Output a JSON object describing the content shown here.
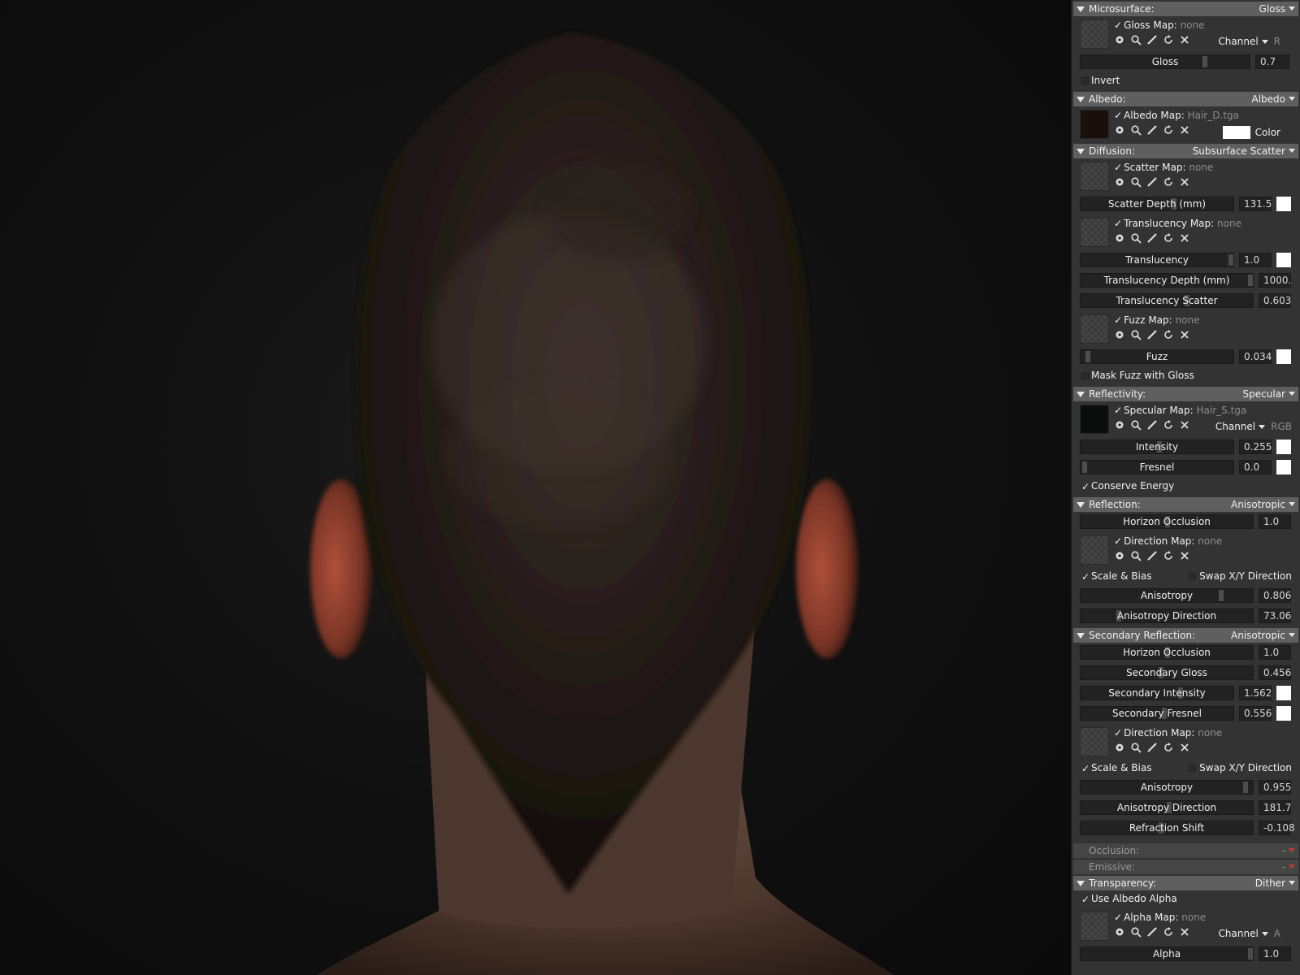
{
  "panel": {
    "microsurface": {
      "title": "Microsurface:",
      "mode": "Gloss",
      "map_label": "Gloss Map:",
      "map_value": "none",
      "channel_label": "Channel",
      "channel_value": "R",
      "gloss_label": "Gloss",
      "gloss_value": "0.7",
      "invert_label": "Invert"
    },
    "albedo": {
      "title": "Albedo:",
      "mode": "Albedo",
      "map_label": "Albedo Map:",
      "map_value": "Hair_D.tga",
      "color_label": "Color"
    },
    "diffusion": {
      "title": "Diffusion:",
      "mode": "Subsurface Scatter",
      "scatter_map_label": "Scatter Map:",
      "scatter_map_value": "none",
      "scatter_depth_label": "Scatter Depth (mm)",
      "scatter_depth_value": "131.5",
      "translucency_map_label": "Translucency Map:",
      "translucency_map_value": "none",
      "translucency_label": "Translucency",
      "translucency_value": "1.0",
      "translucency_depth_label": "Translucency Depth (mm)",
      "translucency_depth_value": "1000.",
      "translucency_scatter_label": "Translucency Scatter",
      "translucency_scatter_value": "0.603",
      "fuzz_map_label": "Fuzz Map:",
      "fuzz_map_value": "none",
      "fuzz_label": "Fuzz",
      "fuzz_value": "0.034",
      "mask_fuzz_label": "Mask Fuzz with Gloss"
    },
    "reflectivity": {
      "title": "Reflectivity:",
      "mode": "Specular",
      "map_label": "Specular Map:",
      "map_value": "Hair_S.tga",
      "channel_label": "Channel",
      "channel_value": "RGB",
      "intensity_label": "Intensity",
      "intensity_value": "0.255",
      "fresnel_label": "Fresnel",
      "fresnel_value": "0.0",
      "conserve_label": "Conserve Energy"
    },
    "reflection": {
      "title": "Reflection:",
      "mode": "Anisotropic",
      "horizon_label": "Horizon Occlusion",
      "horizon_value": "1.0",
      "direction_map_label": "Direction Map:",
      "direction_map_value": "none",
      "scale_bias_label": "Scale & Bias",
      "swap_label": "Swap X/Y Direction",
      "anisotropy_label": "Anisotropy",
      "anisotropy_value": "0.806",
      "aniso_dir_label": "Anisotropy Direction",
      "aniso_dir_value": "73.06"
    },
    "secondary": {
      "title": "Secondary Reflection:",
      "mode": "Anisotropic",
      "horizon_label": "Horizon Occlusion",
      "horizon_value": "1.0",
      "gloss_label": "Secondary Gloss",
      "gloss_value": "0.456",
      "intensity_label": "Secondary Intensity",
      "intensity_value": "1.562",
      "fresnel_label": "Secondary Fresnel",
      "fresnel_value": "0.556",
      "direction_map_label": "Direction Map:",
      "direction_map_value": "none",
      "scale_bias_label": "Scale & Bias",
      "swap_label": "Swap X/Y Direction",
      "anisotropy_label": "Anisotropy",
      "anisotropy_value": "0.955",
      "aniso_dir_label": "Anisotropy Direction",
      "aniso_dir_value": "181.7",
      "refraction_label": "Refraction Shift",
      "refraction_value": "-0.108"
    },
    "occlusion": {
      "title": "Occlusion:",
      "mode": "-"
    },
    "emissive": {
      "title": "Emissive:",
      "mode": "-"
    },
    "transparency": {
      "title": "Transparency:",
      "mode": "Dither",
      "use_albedo_label": "Use Albedo Alpha",
      "map_label": "Alpha Map:",
      "map_value": "none",
      "channel_label": "Channel",
      "channel_value": "A",
      "alpha_label": "Alpha",
      "alpha_value": "1.0"
    }
  }
}
